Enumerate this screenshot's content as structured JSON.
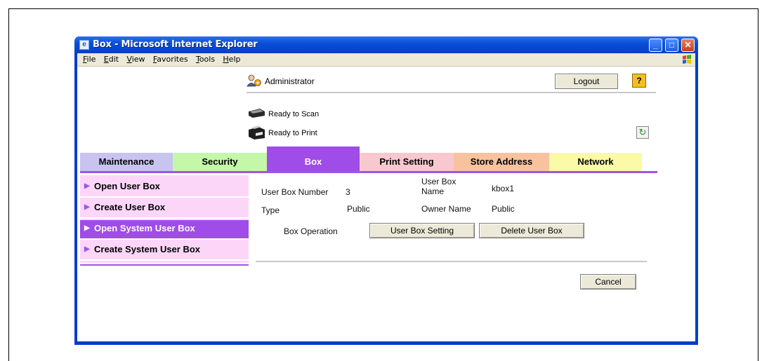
{
  "window": {
    "title": "Box - Microsoft Internet Explorer",
    "buttons": {
      "minimize": "_",
      "maximize": "□",
      "close": "✕"
    }
  },
  "menubar": {
    "items": [
      "File",
      "Edit",
      "View",
      "Favorites",
      "Tools",
      "Help"
    ]
  },
  "header": {
    "user": "Administrator",
    "logout_label": "Logout",
    "help_label": "?",
    "status_scan": "Ready to Scan",
    "status_print": "Ready to Print"
  },
  "tabs": [
    {
      "label": "Maintenance",
      "color": "#c8c4f0"
    },
    {
      "label": "Security",
      "color": "#c4f7a8"
    },
    {
      "label": "Box",
      "color": "#a04ce8",
      "active": true
    },
    {
      "label": "Print Setting",
      "color": "#f8c8d0"
    },
    {
      "label": "Store Address",
      "color": "#f8c29e"
    },
    {
      "label": "Network",
      "color": "#fafaa8"
    }
  ],
  "sidebar": {
    "items": [
      {
        "label": "Open User Box"
      },
      {
        "label": "Create User Box"
      },
      {
        "label": "Open System User Box",
        "selected": true
      },
      {
        "label": "Create System User Box"
      }
    ]
  },
  "details": {
    "user_box_number_label": "User Box Number",
    "user_box_number": "3",
    "user_box_name_label_1": "User Box",
    "user_box_name_label_2": "Name",
    "user_box_name": "kbox1",
    "type_label": "Type",
    "type_value": "Public",
    "owner_name_label": "Owner Name",
    "owner_name_value": "Public",
    "box_operation_label": "Box Operation",
    "user_box_setting_label": "User Box Setting",
    "delete_user_box_label": "Delete User Box",
    "cancel_label": "Cancel"
  },
  "colors": {
    "accent": "#9b56e8",
    "titlebar": "#0a4fd8",
    "menu_bg": "#fbd6f8"
  },
  "icons": [
    "ie-icon",
    "admin-icon",
    "scanner-icon",
    "printer-icon",
    "refresh-icon",
    "help-icon",
    "windows-logo-icon"
  ]
}
